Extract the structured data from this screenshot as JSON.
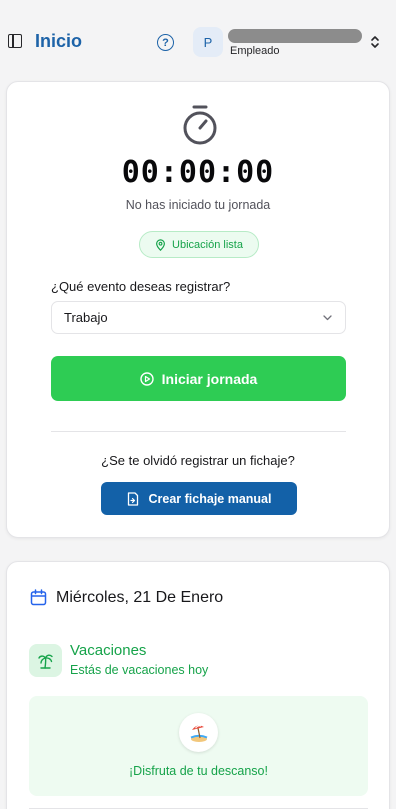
{
  "header": {
    "title": "Inicio",
    "avatar_initial": "P",
    "user_role": "Empleado"
  },
  "clock": {
    "timer": "00:00:00",
    "status": "No has iniciado tu jornada",
    "location_badge": "Ubicación lista",
    "event_question": "¿Qué evento deseas registrar?",
    "event_selected": "Trabajo",
    "start_label": "Iniciar jornada",
    "forgot_text": "¿Se te olvidó registrar un fichaje?",
    "manual_label": "Crear fichaje manual"
  },
  "day": {
    "date": "Miércoles, 21 De Enero",
    "vacation_title": "Vacaciones",
    "vacation_subtitle": "Estás de vacaciones hoy",
    "rest_message": "¡Disfruta de tu descanso!"
  },
  "colors": {
    "brand_blue": "#1d63a8",
    "button_blue": "#1361a8",
    "success_green": "#2ecc54",
    "text_green": "#16a34a"
  },
  "icons": [
    "sidebar-toggle-icon",
    "help-icon",
    "chevron-up-down-icon",
    "stopwatch-icon",
    "map-pin-icon",
    "chevron-down-icon",
    "play-circle-icon",
    "file-sign-icon",
    "calendar-icon",
    "palm-tree-icon",
    "beach-umbrella-icon"
  ]
}
